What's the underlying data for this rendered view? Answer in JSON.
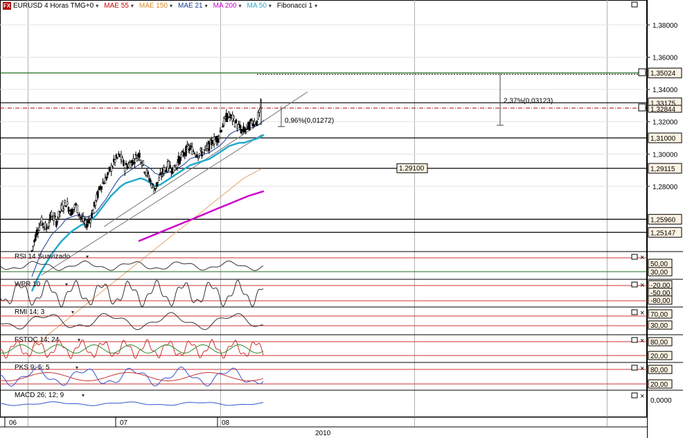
{
  "header": {
    "items": [
      {
        "label": "EURUSD 4 Horas TMG+0",
        "color": "#000000"
      },
      {
        "label": "MAE 55",
        "color": "#cc0000"
      },
      {
        "label": "MAE 150",
        "color": "#d88a22"
      },
      {
        "label": "MAE 21",
        "color": "#1a3b8f"
      },
      {
        "label": "MA 200",
        "color": "#cc00cc"
      },
      {
        "label": "MA 50",
        "color": "#22aacc"
      },
      {
        "label": "Fibonacci 1",
        "color": "#000000"
      }
    ]
  },
  "chart_data": {
    "type": "line",
    "main": {
      "ylim": [
        1.24,
        1.395
      ],
      "yticks": [
        "1,38000",
        "1,36000",
        "1,34000",
        "1,32000",
        "1,30000",
        "1,28000"
      ],
      "ytick_values": [
        1.38,
        1.36,
        1.34,
        1.32,
        1.3,
        1.28
      ],
      "price_series": [
        1.24,
        1.252,
        1.258,
        1.254,
        1.262,
        1.258,
        1.266,
        1.27,
        1.264,
        1.268,
        1.261,
        1.256,
        1.26,
        1.27,
        1.28,
        1.284,
        1.29,
        1.296,
        1.299,
        1.292,
        1.294,
        1.297,
        1.3,
        1.291,
        1.285,
        1.278,
        1.284,
        1.29,
        1.293,
        1.29,
        1.296,
        1.3,
        1.304,
        1.302,
        1.3,
        1.301,
        1.304,
        1.308,
        1.31,
        1.318,
        1.324,
        1.322,
        1.318,
        1.314,
        1.316,
        1.32,
        1.32,
        1.332
      ],
      "ma21_series": [
        1.224,
        1.232,
        1.24,
        1.245,
        1.25,
        1.253,
        1.256,
        1.26,
        1.261,
        1.262,
        1.262,
        1.261,
        1.262,
        1.264,
        1.268,
        1.272,
        1.277,
        1.282,
        1.286,
        1.288,
        1.29,
        1.292,
        1.294,
        1.293,
        1.291,
        1.288,
        1.287,
        1.288,
        1.289,
        1.29,
        1.292,
        1.294,
        1.297,
        1.298,
        1.299,
        1.3,
        1.301,
        1.303,
        1.305,
        1.308,
        1.312,
        1.314,
        1.315,
        1.315,
        1.316,
        1.317,
        1.318,
        1.321
      ],
      "ma50_series": [
        1.215,
        1.222,
        1.228,
        1.233,
        1.238,
        1.242,
        1.246,
        1.249,
        1.252,
        1.254,
        1.256,
        1.257,
        1.259,
        1.262,
        1.266,
        1.27,
        1.274,
        1.277,
        1.28,
        1.282,
        1.283,
        1.284,
        1.285,
        1.284,
        1.282,
        1.28,
        1.281,
        1.283,
        1.285,
        1.287,
        1.289,
        1.291,
        1.293,
        1.294,
        1.295,
        1.296,
        1.297,
        1.299,
        1.301,
        1.303,
        1.305,
        1.306,
        1.307,
        1.307,
        1.308,
        1.309,
        1.31,
        1.312
      ],
      "mae150_series": [
        1.18,
        1.183,
        1.186,
        1.189,
        1.192,
        1.195,
        1.198,
        1.201,
        1.204,
        1.207,
        1.21,
        1.213,
        1.216,
        1.219,
        1.222,
        1.225,
        1.228,
        1.231,
        1.234,
        1.237,
        1.24,
        1.243,
        1.246,
        1.249,
        1.252,
        1.255,
        1.258,
        1.261,
        1.264,
        1.267,
        1.27,
        1.273,
        1.276,
        1.279,
        1.282,
        1.285,
        1.287,
        1.289,
        1.291
      ],
      "ma200_series": [
        1.246,
        1.25,
        1.254,
        1.258,
        1.262,
        1.266,
        1.27,
        1.274,
        1.277
      ],
      "horizontal_levels": [
        {
          "value": 1.35024,
          "label": "1,35024",
          "color": "#1f6b1f"
        },
        {
          "value": 1.33175,
          "label": "1,33175",
          "color": "#000000"
        },
        {
          "value": 1.31,
          "label": "1,31000",
          "color": "#000000"
        },
        {
          "value": 1.29115,
          "label": "1,29115",
          "color": "#000000"
        },
        {
          "value": 1.2596,
          "label": "1,25960",
          "color": "#000000"
        },
        {
          "value": 1.25147,
          "label": "1,25147",
          "color": "#000000"
        }
      ],
      "current_price": {
        "value": 1.32844,
        "label": "1,32844",
        "color": "#aa0000"
      },
      "mid_label": {
        "value": 1.291,
        "label": "1.29100"
      },
      "measures": [
        {
          "label": "0,96%(0,01272)"
        },
        {
          "label": "2,37%(0,03123)"
        }
      ]
    },
    "subpanels": [
      {
        "name": "RSI 14 Suavizado",
        "levels": [
          "50,00",
          "30,00"
        ]
      },
      {
        "name": "WPR 10",
        "levels": [
          "-20,00",
          "-50,00",
          "-80,00"
        ]
      },
      {
        "name": "RMI 14; 3",
        "levels": [
          "70,00",
          "30,00"
        ]
      },
      {
        "name": "FSTOC 14; 24",
        "levels": [
          "80,00",
          "20,00"
        ]
      },
      {
        "name": "PKS 9; 5; 5",
        "levels": [
          "80,00",
          "20,00"
        ]
      },
      {
        "name": "MACD 26; 12; 9",
        "levels": [
          "0,0000"
        ]
      }
    ],
    "xticks": [
      "06",
      "07",
      "08"
    ],
    "year_label": "2010"
  }
}
